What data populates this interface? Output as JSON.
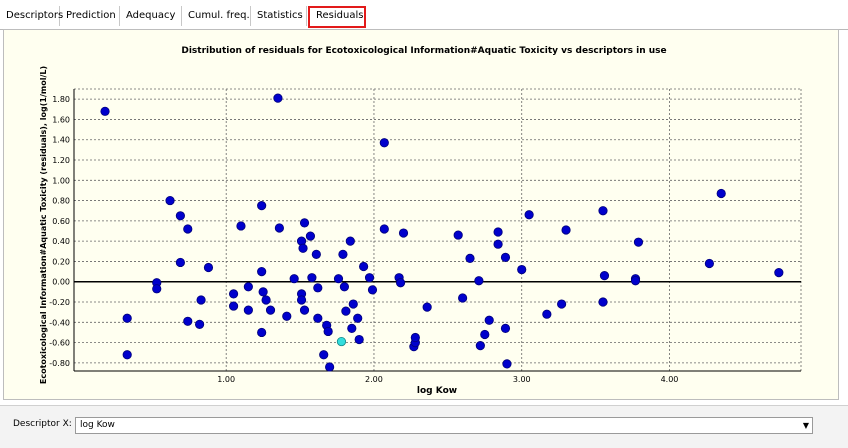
{
  "tabs": [
    {
      "label": "Descriptors",
      "active": false
    },
    {
      "label": "Prediction",
      "active": false
    },
    {
      "label": "Adequacy",
      "active": false
    },
    {
      "label": "Cumul. freq.",
      "active": false
    },
    {
      "label": "Statistics",
      "active": false
    },
    {
      "label": "Residuals",
      "active": true
    }
  ],
  "descriptor_x": {
    "label": "Descriptor X:",
    "value": "log Kow"
  },
  "chart_data": {
    "type": "scatter",
    "title": "Distribution of residuals for Ecotoxicological Information#Aquatic Toxicity vs descriptors in use",
    "xlabel": "log Kow",
    "ylabel": "Ecotoxicological Information#Aquatic Toxicity (residuals), log(1/mol/L)",
    "xlim": [
      -0.03,
      4.89
    ],
    "ylim": [
      -0.88,
      1.9
    ],
    "x_ticks": [
      "1.00",
      "2.00",
      "3.00",
      "4.00"
    ],
    "x_tick_values": [
      1,
      2,
      3,
      4
    ],
    "y_ticks": [
      "1.80",
      "1.60",
      "1.40",
      "1.20",
      "1.00",
      "0.80",
      "0.60",
      "0.40",
      "0.20",
      "0.00",
      "-0.20",
      "-0.40",
      "-0.60",
      "-0.80"
    ],
    "y_tick_values": [
      1.8,
      1.6,
      1.4,
      1.2,
      1.0,
      0.8,
      0.6,
      0.4,
      0.2,
      0.0,
      -0.2,
      -0.4,
      -0.6,
      -0.8
    ],
    "grid": true,
    "point_color": "#0000cc",
    "highlight_color": "#33dddd",
    "points": [
      [
        0.18,
        1.68
      ],
      [
        1.35,
        1.81
      ],
      [
        2.07,
        1.37
      ],
      [
        0.33,
        -0.36
      ],
      [
        0.33,
        -0.72
      ],
      [
        0.53,
        -0.01
      ],
      [
        0.53,
        -0.07
      ],
      [
        0.62,
        0.8
      ],
      [
        0.69,
        0.65
      ],
      [
        0.69,
        0.19
      ],
      [
        0.74,
        0.52
      ],
      [
        0.74,
        -0.39
      ],
      [
        0.82,
        -0.42
      ],
      [
        0.83,
        -0.18
      ],
      [
        0.88,
        0.14
      ],
      [
        1.05,
        -0.12
      ],
      [
        1.05,
        -0.24
      ],
      [
        1.1,
        0.55
      ],
      [
        1.15,
        -0.05
      ],
      [
        1.15,
        -0.28
      ],
      [
        1.24,
        0.75
      ],
      [
        1.24,
        0.1
      ],
      [
        1.25,
        -0.1
      ],
      [
        1.27,
        -0.18
      ],
      [
        1.24,
        -0.5
      ],
      [
        1.3,
        -0.28
      ],
      [
        1.36,
        0.53
      ],
      [
        1.41,
        -0.34
      ],
      [
        1.46,
        0.03
      ],
      [
        1.51,
        0.4
      ],
      [
        1.52,
        0.33
      ],
      [
        1.53,
        0.58
      ],
      [
        1.51,
        -0.12
      ],
      [
        1.51,
        -0.18
      ],
      [
        1.53,
        -0.28
      ],
      [
        1.57,
        0.45
      ],
      [
        1.58,
        0.04
      ],
      [
        1.61,
        0.27
      ],
      [
        1.62,
        -0.06
      ],
      [
        1.62,
        -0.36
      ],
      [
        1.66,
        -0.72
      ],
      [
        1.68,
        -0.43
      ],
      [
        1.69,
        -0.49
      ],
      [
        1.7,
        -0.84
      ],
      [
        1.76,
        0.03
      ],
      [
        1.79,
        0.27
      ],
      [
        1.8,
        -0.05
      ],
      [
        1.81,
        -0.29
      ],
      [
        1.84,
        0.4
      ],
      [
        1.85,
        -0.46
      ],
      [
        1.86,
        -0.22
      ],
      [
        1.89,
        -0.36
      ],
      [
        1.9,
        -0.57
      ],
      [
        1.93,
        0.15
      ],
      [
        1.97,
        0.04
      ],
      [
        1.99,
        -0.08
      ],
      [
        2.07,
        0.52
      ],
      [
        2.17,
        0.04
      ],
      [
        2.18,
        -0.01
      ],
      [
        2.2,
        0.48
      ],
      [
        2.27,
        -0.64
      ],
      [
        2.28,
        -0.6
      ],
      [
        2.28,
        -0.55
      ],
      [
        2.36,
        -0.25
      ],
      [
        2.57,
        0.46
      ],
      [
        2.6,
        -0.16
      ],
      [
        2.65,
        0.23
      ],
      [
        2.71,
        0.01
      ],
      [
        2.72,
        -0.63
      ],
      [
        2.75,
        -0.52
      ],
      [
        2.78,
        -0.38
      ],
      [
        2.84,
        0.49
      ],
      [
        2.84,
        0.37
      ],
      [
        2.89,
        0.24
      ],
      [
        2.89,
        -0.46
      ],
      [
        2.9,
        -0.81
      ],
      [
        3.0,
        0.12
      ],
      [
        3.05,
        0.66
      ],
      [
        3.17,
        -0.32
      ],
      [
        3.27,
        -0.22
      ],
      [
        3.3,
        0.51
      ],
      [
        3.55,
        0.7
      ],
      [
        3.56,
        0.06
      ],
      [
        3.55,
        -0.2
      ],
      [
        3.77,
        0.03
      ],
      [
        3.77,
        0.01
      ],
      [
        3.79,
        0.39
      ],
      [
        4.27,
        0.18
      ],
      [
        4.35,
        0.87
      ],
      [
        4.74,
        0.09
      ]
    ],
    "highlight_points": [
      [
        1.78,
        -0.59
      ]
    ]
  }
}
